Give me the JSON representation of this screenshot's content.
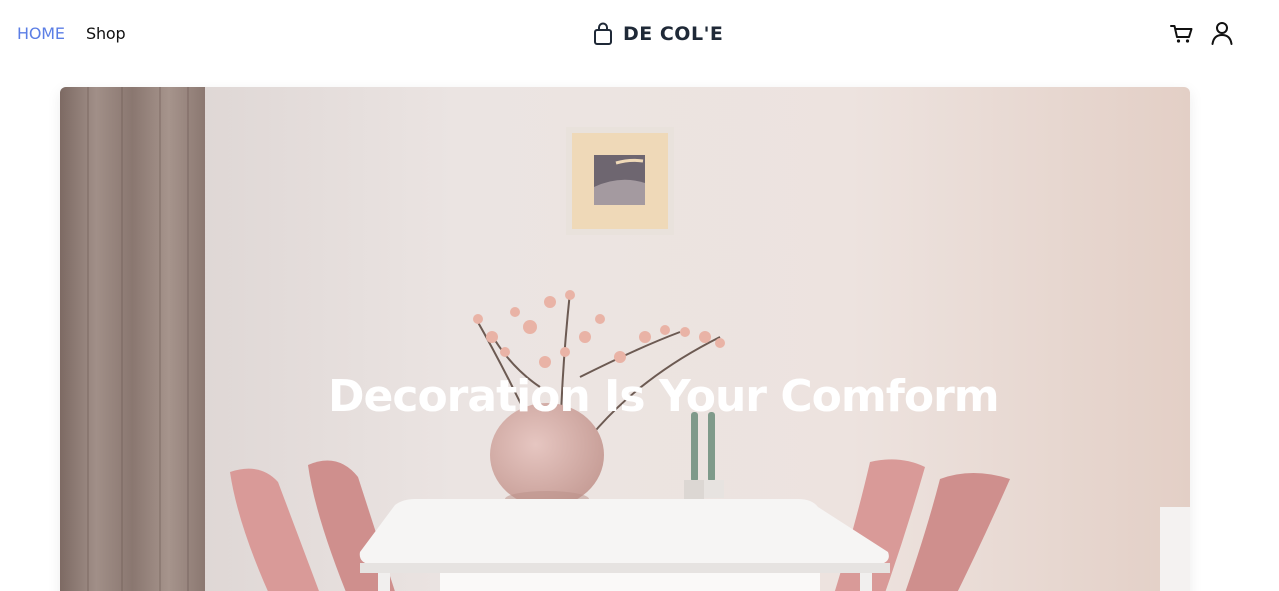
{
  "nav": {
    "home_label": "HOME",
    "shop_label": "Shop",
    "home_color": "#5b7ee5"
  },
  "brand": {
    "name": "DE COL'E",
    "icon": "shopping-bag-icon"
  },
  "actions": {
    "cart_icon": "cart-icon",
    "user_icon": "user-icon"
  },
  "hero": {
    "title": "Decoration Is Your Comform",
    "image": "dining-room-photo"
  }
}
